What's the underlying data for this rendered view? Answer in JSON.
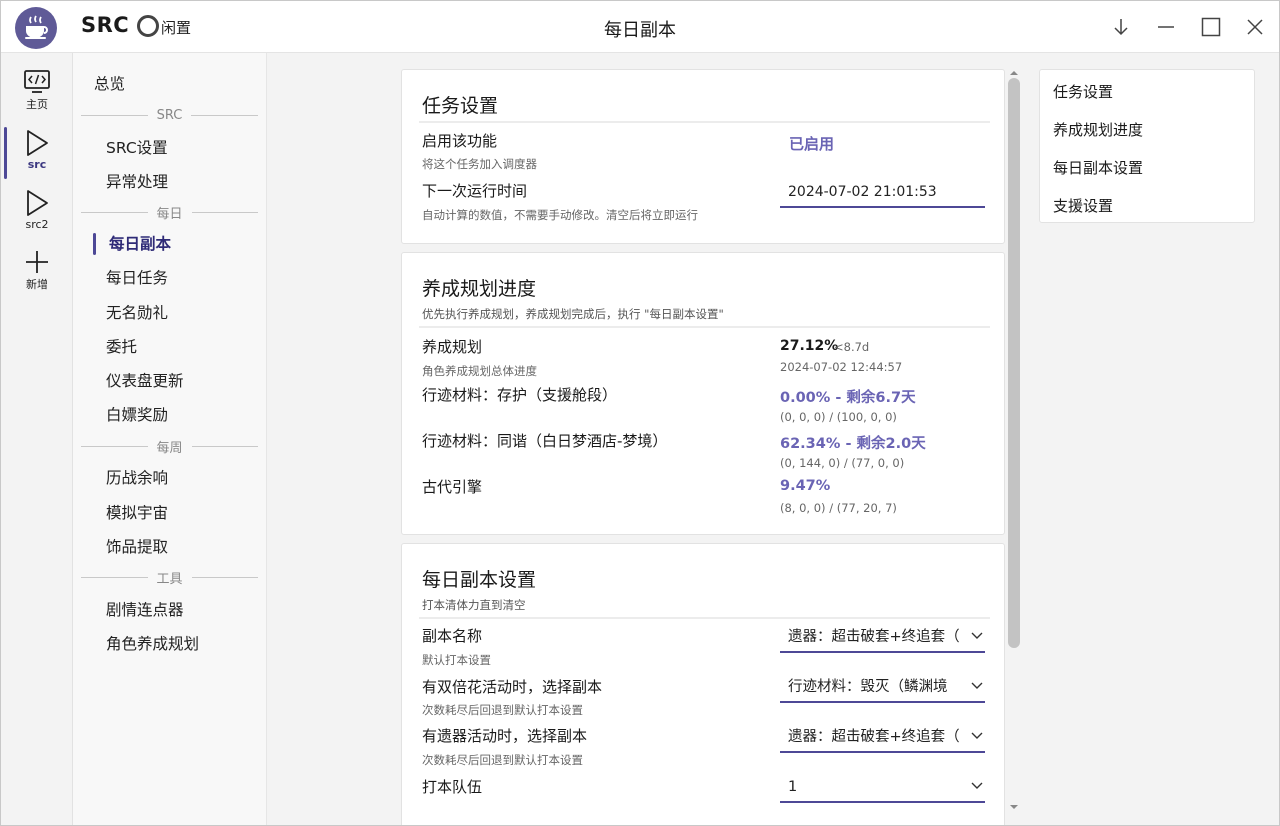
{
  "app": {
    "name": "SRC",
    "status": "闲置",
    "window_title": "每日副本"
  },
  "colors": {
    "accent": "#4d4896",
    "accent_text": "#6a64b4",
    "logo_bg": "#5f5a97"
  },
  "rail": [
    {
      "label": "主页",
      "icon": "code-screen-icon"
    },
    {
      "label": "src",
      "icon": "play-icon",
      "active": true
    },
    {
      "label": "src2",
      "icon": "play-icon"
    },
    {
      "label": "新增",
      "icon": "plus-icon"
    }
  ],
  "sidebar": {
    "overview": "总览",
    "sections": [
      {
        "title": "SRC",
        "items": [
          "SRC设置",
          "异常处理"
        ]
      },
      {
        "title": "每日",
        "items": [
          "每日副本",
          "每日任务",
          "无名勋礼",
          "委托",
          "仪表盘更新",
          "白嫖奖励"
        ]
      },
      {
        "title": "每周",
        "items": [
          "历战余响",
          "模拟宇宙",
          "饰品提取"
        ]
      },
      {
        "title": "工具",
        "items": [
          "剧情连点器",
          "角色养成规划"
        ]
      }
    ],
    "active": "每日副本"
  },
  "task": {
    "title": "任务设置",
    "enable_label": "启用该功能",
    "enable_desc": "将这个任务加入调度器",
    "enable_value": "已启用",
    "next_run_label": "下一次运行时间",
    "next_run_desc": "自动计算的数值，不需要手动修改。清空后将立即运行",
    "next_run_value": "2024-07-02 21:01:53"
  },
  "progress": {
    "title": "养成规划进度",
    "subtitle": "优先执行养成规划，养成规划完成后，执行 \"每日副本设置\"",
    "overall_label": "养成规划",
    "overall_desc": "角色养成规划总体进度",
    "overall_value": "27.12%",
    "overall_eta": "<8.7d",
    "overall_time": "2024-07-02 12:44:57",
    "items": [
      {
        "label": "行迹材料：存护（支援舱段）",
        "value": "0.00% - 剩余6.7天",
        "detail": "(0, 0, 0) / (100, 0, 0)"
      },
      {
        "label": "行迹材料：同谐（白日梦酒店-梦境）",
        "value": "62.34% - 剩余2.0天",
        "detail": "(0, 144, 0) / (77, 0, 0)"
      },
      {
        "label": "古代引擎",
        "value": "9.47%",
        "detail": "(8, 0, 0) / (77, 20, 7)"
      }
    ]
  },
  "daily": {
    "title": "每日副本设置",
    "subtitle": "打本清体力直到清空",
    "rows": [
      {
        "label": "副本名称",
        "desc": "默认打本设置",
        "value": "遗器：超击破套+终追套（"
      },
      {
        "label": "有双倍花活动时，选择副本",
        "desc": "次数耗尽后回退到默认打本设置",
        "value": "行迹材料：毁灭（鳞渊境"
      },
      {
        "label": "有遗器活动时，选择副本",
        "desc": "次数耗尽后回退到默认打本设置",
        "value": "遗器：超击破套+终追套（"
      },
      {
        "label": "打本队伍",
        "desc": "",
        "value": "1"
      }
    ]
  },
  "toc": [
    "任务设置",
    "养成规划进度",
    "每日副本设置",
    "支援设置"
  ]
}
